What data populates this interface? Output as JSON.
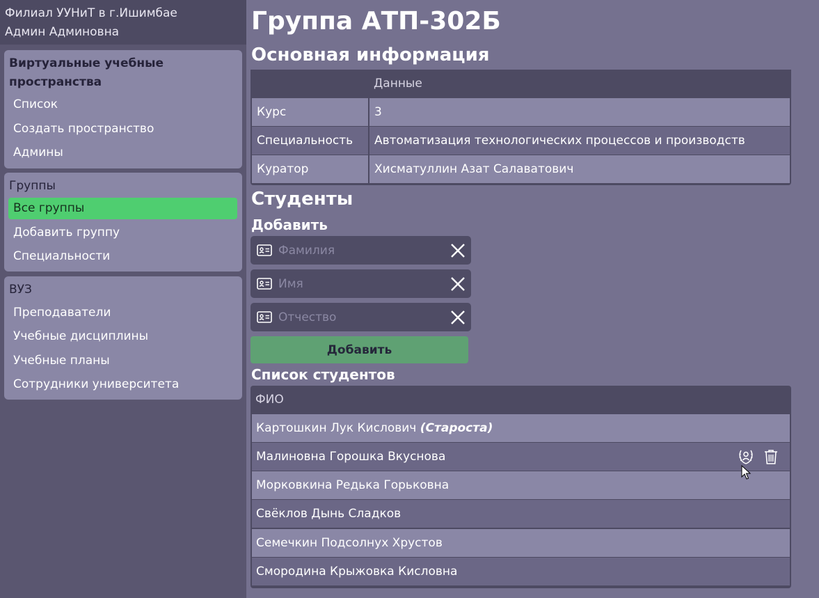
{
  "sidebar": {
    "org": "Филиал УУНиТ в г.Ишимбае",
    "user": "Админ Админовна",
    "sections": [
      {
        "title_line1": "Виртуальные учебные",
        "title_line2": "пространства",
        "items": [
          "Список",
          "Создать пространство",
          "Админы"
        ]
      },
      {
        "title": "Группы",
        "items": [
          "Все группы",
          "Добавить группу",
          "Специальности"
        ],
        "active": "Все группы"
      },
      {
        "title": "ВУЗ",
        "items": [
          "Преподаватели",
          "Учебные дисциплины",
          "Учебные планы",
          "Сотрудники университета"
        ]
      }
    ]
  },
  "main": {
    "title": "Группа АТП-302Б",
    "info": {
      "heading": "Основная информация",
      "col_header": "Данные",
      "rows": [
        {
          "label": "Курс",
          "value": "3"
        },
        {
          "label": "Специальность",
          "value": "Автоматизация технологических процессов и производств"
        },
        {
          "label": "Куратор",
          "value": "Хисматуллин Азат Салаватович"
        }
      ]
    },
    "students": {
      "heading": "Студенты",
      "add_heading": "Добавить",
      "placeholders": {
        "last_name": "Фамилия",
        "first_name": "Имя",
        "patronymic": "Отчество"
      },
      "add_button": "Добавить",
      "list_heading": "Список студентов",
      "col_header": "ФИО",
      "rows": [
        {
          "name": "Картошкин Лук Кислович",
          "role": "(Староста)"
        },
        {
          "name": "Малиновна Горошка Вкуснова",
          "role": ""
        },
        {
          "name": "Морковкина Редька Горьковна",
          "role": ""
        },
        {
          "name": "Свёклов Дынь Сладков",
          "role": ""
        },
        {
          "name": "Семечкин Подсолнух Хрустов",
          "role": ""
        },
        {
          "name": "Смородина Крыжовка Кисловна",
          "role": ""
        }
      ]
    }
  },
  "colors": {
    "active_item": "#4fce70",
    "add_button": "#5fa173",
    "background": "#75718f",
    "sidebar": "#5a5670"
  },
  "icons": {
    "id_card": "id-card-icon",
    "clear": "close-icon",
    "make_head": "laurel-user-icon",
    "delete": "trash-icon"
  }
}
